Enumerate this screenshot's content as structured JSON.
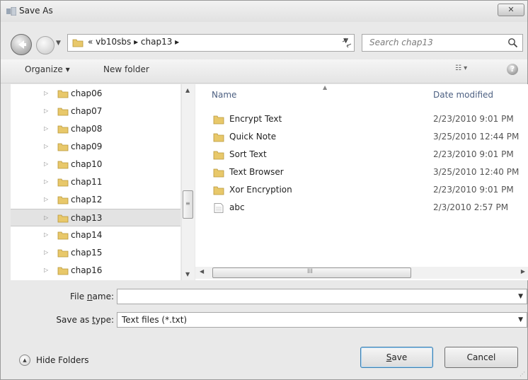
{
  "window": {
    "title": "Save As",
    "close_glyph": "✕"
  },
  "nav": {
    "address_text": "« vb10sbs ▸ chap13 ▸",
    "search_placeholder": "Search chap13"
  },
  "toolbar": {
    "organize_label": "Organize ▾",
    "new_folder_label": "New folder",
    "view_label": "☷ ▾",
    "help_label": "?"
  },
  "tree": {
    "items": [
      {
        "label": "chap06"
      },
      {
        "label": "chap07"
      },
      {
        "label": "chap08"
      },
      {
        "label": "chap09"
      },
      {
        "label": "chap10"
      },
      {
        "label": "chap11"
      },
      {
        "label": "chap12"
      },
      {
        "label": "chap13",
        "selected": true
      },
      {
        "label": "chap14"
      },
      {
        "label": "chap15"
      },
      {
        "label": "chap16"
      }
    ]
  },
  "list": {
    "columns": {
      "name": "Name",
      "date": "Date modified"
    },
    "rows": [
      {
        "name": "Encrypt Text",
        "date": "2/23/2010 9:01 PM",
        "icon": "folder-icon"
      },
      {
        "name": "Quick Note",
        "date": "3/25/2010 12:44 PM",
        "icon": "folder-icon"
      },
      {
        "name": "Sort Text",
        "date": "2/23/2010 9:01 PM",
        "icon": "folder-icon"
      },
      {
        "name": "Text Browser",
        "date": "3/25/2010 12:40 PM",
        "icon": "folder-icon"
      },
      {
        "name": "Xor Encryption",
        "date": "2/23/2010 9:01 PM",
        "icon": "folder-icon"
      },
      {
        "name": "abc",
        "date": "2/3/2010 2:57 PM",
        "icon": "text-file-icon"
      }
    ],
    "hscroll_grip": "III"
  },
  "form": {
    "file_name_label_pre": "File ",
    "file_name_label_ul": "n",
    "file_name_label_post": "ame:",
    "file_name_value": "",
    "save_type_label_pre": "Save as ",
    "save_type_label_ul": "t",
    "save_type_label_post": "ype:",
    "save_type_value": "Text files (*.txt)"
  },
  "footer": {
    "hide_folders_label": "Hide Folders",
    "save_label_ul": "S",
    "save_label_post": "ave",
    "cancel_label": "Cancel"
  },
  "colors": {
    "column_header": "#4d6082",
    "folder": "#e8c86a",
    "selection": "#e3e3e3"
  }
}
